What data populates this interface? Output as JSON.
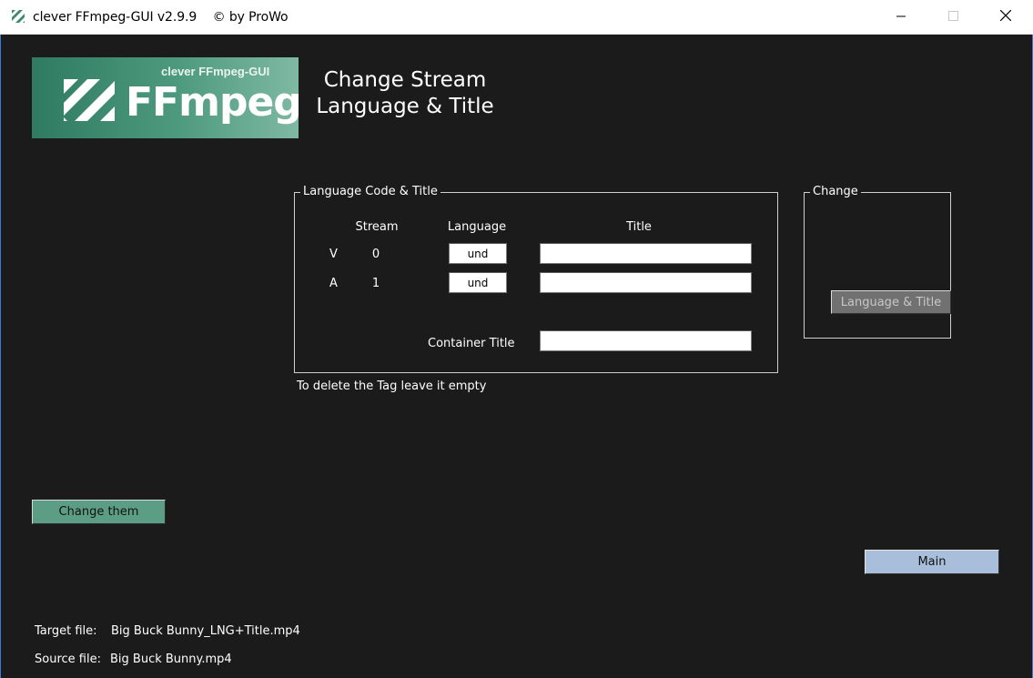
{
  "window": {
    "title": "clever FFmpeg-GUI v2.9.9    © by ProWo",
    "controls": {
      "minimize": "minimize-icon",
      "maximize": "maximize-icon",
      "close": "close-icon"
    }
  },
  "logo": {
    "subtitle": "clever FFmpeg-GUI",
    "name": "FFmpeg",
    "colors": {
      "from": "#2e7b61",
      "to": "#7fb9a2"
    }
  },
  "heading": {
    "line1": "Change Stream",
    "line2": "Language & Title"
  },
  "language_group": {
    "label": "Language Code & Title",
    "columns": {
      "stream": "Stream",
      "language": "Language",
      "title": "Title"
    },
    "rows": [
      {
        "type": "V",
        "stream": "0",
        "language": "und",
        "title": ""
      },
      {
        "type": "A",
        "stream": "1",
        "language": "und",
        "title": ""
      }
    ],
    "container_title_label": "Container Title",
    "container_title_value": ""
  },
  "hint": "To delete the Tag leave it empty",
  "change_group": {
    "label": "Change",
    "button": "Language & Title"
  },
  "buttons": {
    "change_them": "Change them",
    "main": "Main"
  },
  "files": {
    "target_label": "Target file:",
    "target_value": "Big Buck Bunny_LNG+Title.mp4",
    "source_label": "Source file:",
    "source_value": "Big Buck Bunny.mp4"
  },
  "colors": {
    "background": "#1b1b1b",
    "accent_green": "#5c9e85",
    "main_button": "#a9bedb",
    "disabled_button": "#717171"
  }
}
